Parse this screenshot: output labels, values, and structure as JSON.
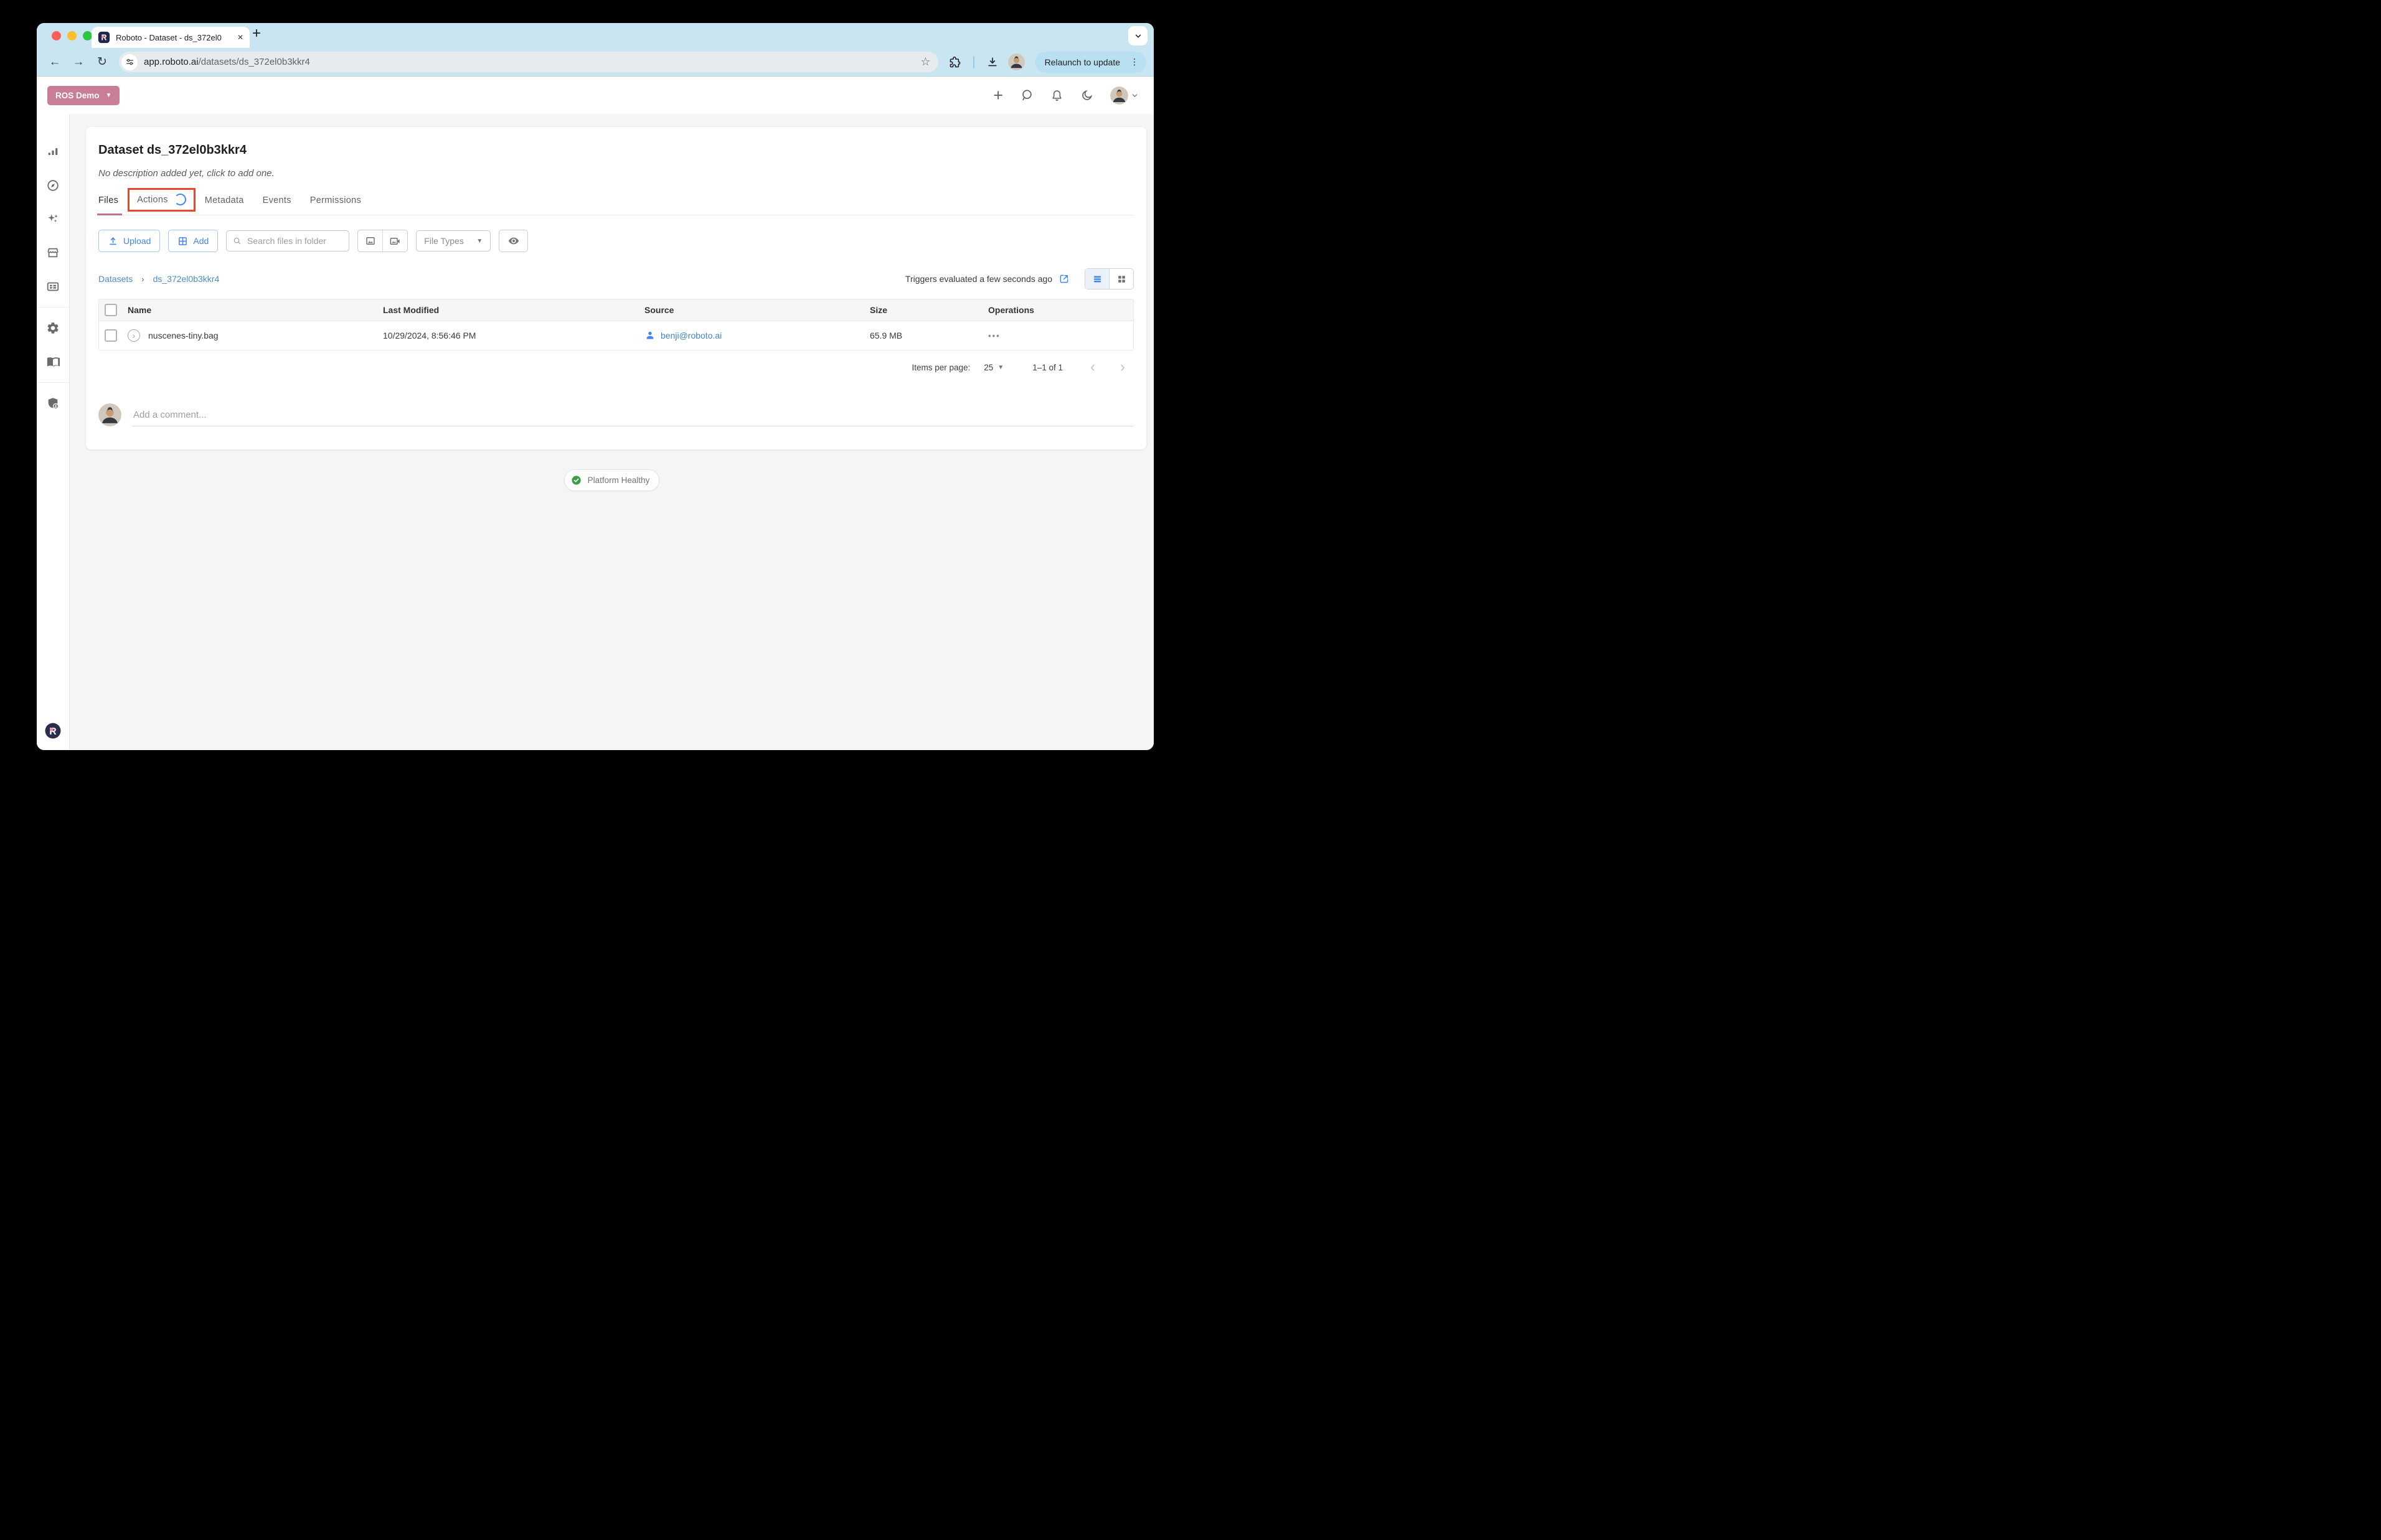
{
  "colors": {
    "chrome_blue": "#c9e5f2",
    "accent_blue": "#4285f4",
    "link_blue": "#4c8dcb",
    "rose": "#c87f95",
    "annotation_red": "#e8472b",
    "healthy_green": "#3f9d44"
  },
  "browser": {
    "tab_title": "Roboto - Dataset - ds_372el0",
    "new_tab_button": "+",
    "url_domain": "app.roboto.ai",
    "url_path": "/datasets/ds_372el0b3kkr4",
    "relaunch_button": "Relaunch to update"
  },
  "app_header": {
    "workspace": "ROS Demo"
  },
  "page": {
    "title": "Dataset ds_372el0b3kkr4",
    "description": "No description added yet, click to add one.",
    "tabs": [
      {
        "label": "Files",
        "active": true
      },
      {
        "label": "Actions",
        "loading": true,
        "annotated": true
      },
      {
        "label": "Metadata"
      },
      {
        "label": "Events"
      },
      {
        "label": "Permissions"
      }
    ],
    "toolbar": {
      "upload": "Upload",
      "add": "Add",
      "search_placeholder": "Search files in folder",
      "file_types": "File Types"
    },
    "breadcrumb": {
      "root": "Datasets",
      "current": "ds_372el0b3kkr4"
    },
    "triggers_status": "Triggers evaluated a few seconds ago",
    "table": {
      "columns": [
        "Name",
        "Last Modified",
        "Source",
        "Size",
        "Operations"
      ],
      "rows": [
        {
          "name": "nuscenes-tiny.bag",
          "last_modified": "10/29/2024, 8:56:46 PM",
          "source": "benji@roboto.ai",
          "size": "65.9 MB",
          "operations": "•••"
        }
      ]
    },
    "pagination": {
      "items_per_page_label": "Items per page:",
      "per_page": "25",
      "range": "1–1 of 1"
    },
    "comment_placeholder": "Add a comment...",
    "status_badge": "Platform Healthy"
  }
}
